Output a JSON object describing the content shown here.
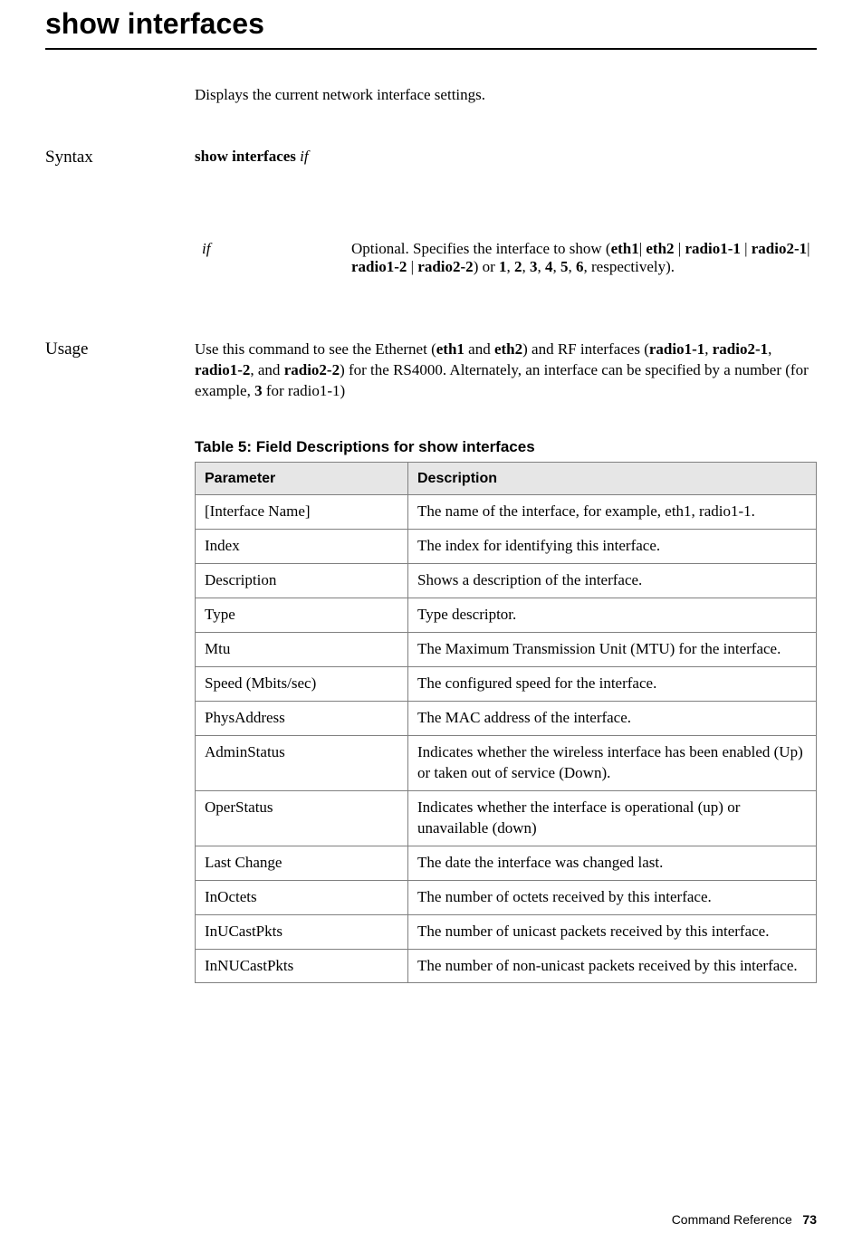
{
  "title": "show interfaces",
  "intro": "Displays the current network interface settings.",
  "syntax": {
    "label": "Syntax",
    "command_bold": "show interfaces ",
    "command_italic": "if"
  },
  "param": {
    "name": "if",
    "desc_pre": "Optional. Specifies the  interface to show (",
    "eth1": "eth1",
    "pipe1": "| ",
    "eth2": "eth2",
    "pipe2": " | ",
    "radio11": "radio1-1",
    "pipe3": " | ",
    "radio21": "radio2-1",
    "pipe4": "| ",
    "radio12": "radio1-2",
    "pipe5": " | ",
    "radio22": "radio2-2",
    "desc_mid": ") or ",
    "n1": "1",
    "c1": ", ",
    "n2": "2",
    "c2": ", ",
    "n3": "3",
    "c3": ", ",
    "n4": "4",
    "c4": ", ",
    "n5": "5",
    "c5": ", ",
    "n6": "6",
    "desc_end": ", respectively)."
  },
  "usage": {
    "label": "Usage",
    "t1": "Use this command to see the Ethernet (",
    "eth1": "eth1",
    "t2": " and ",
    "eth2": "eth2",
    "t3": ") and RF interfaces (",
    "radio11": "radio1-1",
    "t4": ", ",
    "radio21": "radio2-1",
    "t5": ",  ",
    "radio12": "radio1-2",
    "t6": ", and  ",
    "radio22": "radio2-2",
    "t7": ") for the RS4000. Alternately, an interface can be specified by a number (for example, ",
    "three": "3",
    "t8": " for radio1-1)"
  },
  "table": {
    "caption": "Table 5: Field Descriptions for show interfaces",
    "header": {
      "param": "Parameter",
      "desc": "Description"
    },
    "rows": [
      {
        "param": "[Interface Name]",
        "desc": "The name of the interface, for example, eth1, radio1-1."
      },
      {
        "param": "Index",
        "desc": "The index for identifying this interface."
      },
      {
        "param": "Description",
        "desc": "Shows a description of the interface."
      },
      {
        "param": "Type",
        "desc": "Type descriptor."
      },
      {
        "param": "Mtu",
        "desc": "The Maximum Transmission Unit (MTU) for the interface."
      },
      {
        "param": "Speed (Mbits/sec)",
        "desc": "The configured speed for the interface."
      },
      {
        "param": "PhysAddress",
        "desc": "The MAC address of the interface."
      },
      {
        "param": "AdminStatus",
        "desc": "Indicates whether the wireless interface has been enabled (Up) or taken out of service (Down)."
      },
      {
        "param": "OperStatus",
        "desc": "Indicates whether the interface is operational (up) or unavailable (down)"
      },
      {
        "param": "Last Change",
        "desc": "The date the interface was changed last."
      },
      {
        "param": "InOctets",
        "desc": "The number of octets received by this interface."
      },
      {
        "param": "InUCastPkts",
        "desc": "The number of unicast packets received by this interface."
      },
      {
        "param": "InNUCastPkts",
        "desc": "The number of non-unicast packets received by this interface."
      }
    ]
  },
  "footer": {
    "text": "Command Reference",
    "page": "73"
  }
}
